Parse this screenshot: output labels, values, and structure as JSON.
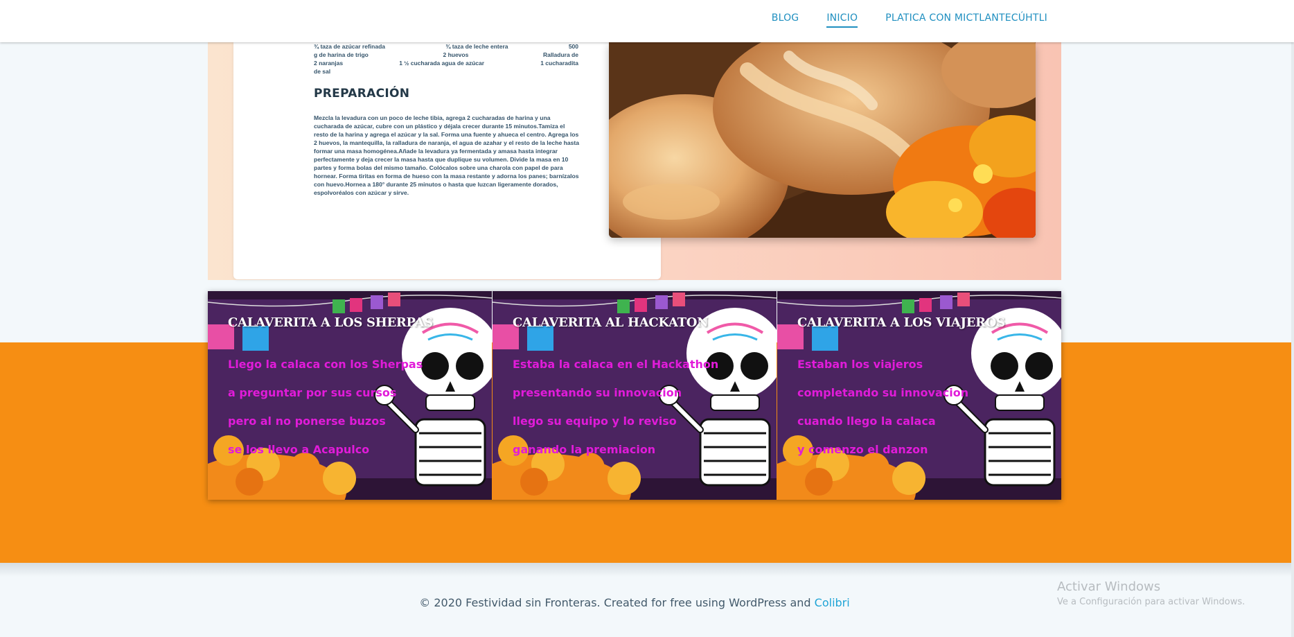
{
  "nav": {
    "items": [
      {
        "label": "BLOG",
        "active": false
      },
      {
        "label": "INICIO",
        "active": true
      },
      {
        "label": "PLATICA CON MICTLANTECÚHTLI",
        "active": false
      }
    ]
  },
  "recipe": {
    "ingredients_rows": [
      [
        "¾ taza de azúcar refinada",
        "¾ taza de leche entera",
        "500"
      ],
      [
        "g de harina de trigo",
        "2 huevos",
        "Ralladura de"
      ],
      [
        "2 naranjas",
        "1 ½ cucharada agua de azúcar",
        "1 cucharadita"
      ],
      [
        "de sal",
        "",
        ""
      ]
    ],
    "preparation_title": "PREPARACIÓN",
    "preparation_text": "Mezcla la levadura con un poco de leche tibia, agrega 2 cucharadas de harina y una cucharada de azúcar, cubre con un plástico y déjala crecer durante 15 minutos.Tamiza el resto de la harina y agrega el azúcar y la sal. Forma una fuente y ahueca el centro. Agrega los 2 huevos, la mantequilla, la ralladura de naranja, el agua de azahar y el resto de la leche hasta formar una masa homogénea.Añade la levadura ya fermentada y amasa hasta integrar perfectamente y deja crecer la masa hasta que duplique su volumen. Divide la masa en 10 partes y forma bolas del mismo tamaño. Colócalos sobre una charola con papel de para hornear. Forma tiritas en forma de hueso con la masa restante y adorna los panes; barnízalos con huevo.Hornea a 180° durante 25 minutos o hasta que luzcan ligeramente dorados, espolvoréalos con azúcar y sirve."
  },
  "calaveritas": [
    {
      "title": "CALAVERITA A LOS SHERPAS",
      "lines": [
        "Llego la calaca con los Sherpas",
        "a preguntar por sus cursos",
        "pero al no ponerse buzos",
        "se los llevo a Acapulco"
      ]
    },
    {
      "title": "CALAVERITA AL HACKATON",
      "lines": [
        "Estaba la calaca en el Hackathon",
        "presentando su innovacion",
        "llego su equipo y lo reviso",
        "ganando la premiacion"
      ]
    },
    {
      "title": "CALAVERITA A LOS VIAJEROS",
      "lines": [
        "Estaban los viajeros",
        "completando su innovacion",
        "cuando llego la calaca",
        "y comenzo el danzon"
      ]
    }
  ],
  "footer": {
    "text": "© 2020 Festividad sin Fronteras. Created for free using WordPress and ",
    "link": "Colibri"
  },
  "watermark": {
    "title": "Activar Windows",
    "subtitle": "Ve a Configuración para activar Windows."
  },
  "colors": {
    "nav_link": "#1f8fc0",
    "orange_band": "#f68e13",
    "verse_magenta": "#e11bd9",
    "panel_purple": "#4b2460"
  }
}
